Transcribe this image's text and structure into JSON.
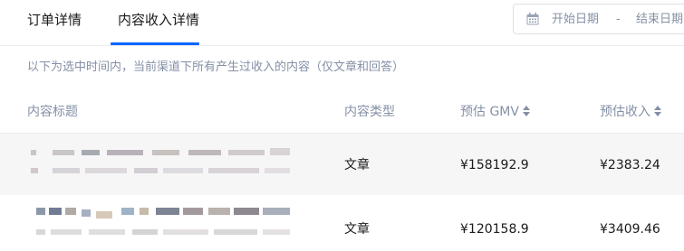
{
  "tabs": [
    {
      "label": "订单详情",
      "active": false
    },
    {
      "label": "内容收入详情",
      "active": true
    }
  ],
  "date_range": {
    "start_placeholder": "开始日期",
    "separator": "-",
    "end_placeholder": "结束日期"
  },
  "description": "以下为选中时间内，当前渠道下所有产生过收入的内容（仅文章和回答）",
  "table": {
    "headers": {
      "title": "内容标题",
      "type": "内容类型",
      "gmv": "预估 GMV",
      "income": "预估收入"
    },
    "rows": [
      {
        "type": "文章",
        "gmv": "¥158192.9",
        "income": "¥2383.24"
      },
      {
        "type": "文章",
        "gmv": "¥120158.9",
        "income": "¥3409.46"
      }
    ]
  },
  "colors": {
    "accent": "#0066ff",
    "muted_text": "#8590a6",
    "row_highlight": "#f6f6f6"
  }
}
